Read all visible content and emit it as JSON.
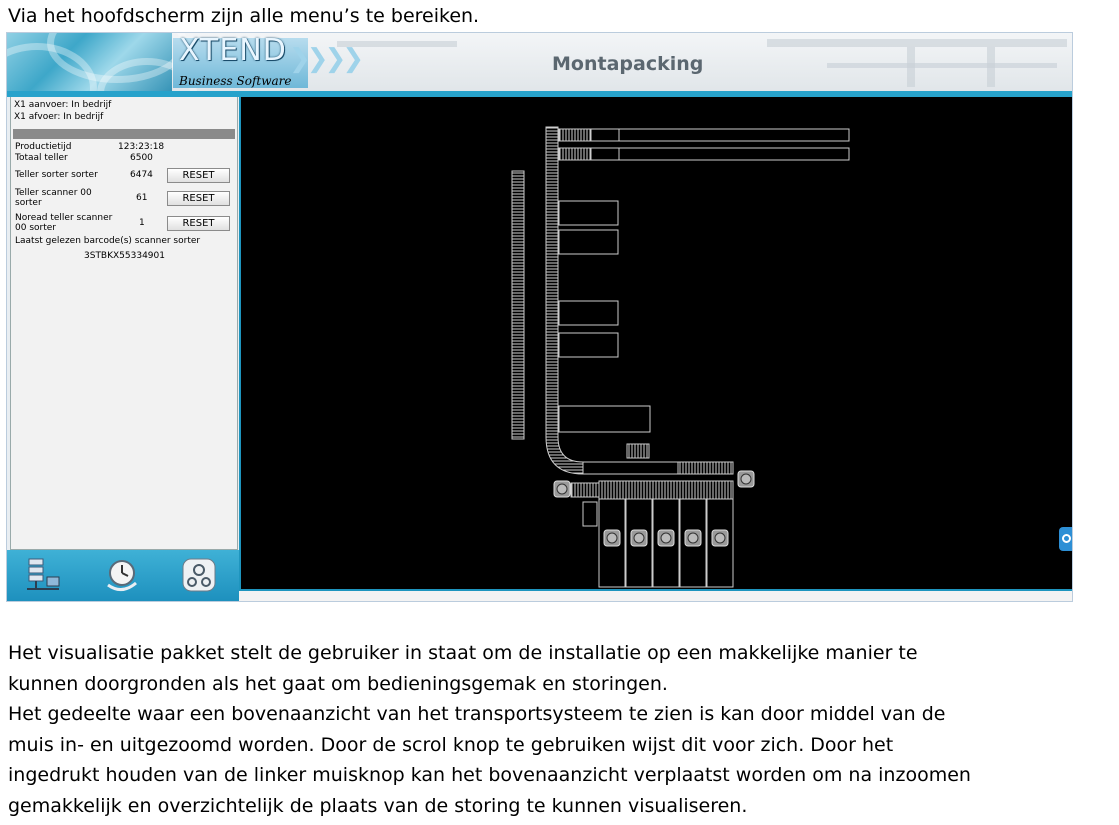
{
  "intro": "Via het hoofdscherm zijn alle menu’s te bereiken.",
  "app": {
    "logo_word": "XTEND",
    "logo_subtitle": "Business Software",
    "title": "Montapacking"
  },
  "status": {
    "line1": "X1 aanvoer: In bedrijf",
    "line2": "X1 afvoer:  In bedrijf"
  },
  "counters": {
    "productietijd_label": "Productietijd",
    "productietijd_value": "123:23:18",
    "totaal_label": "Totaal teller",
    "totaal_value": "6500",
    "sorter_label": "Teller sorter sorter",
    "sorter_value": "6474",
    "scanner_label_1": "Teller scanner 00",
    "scanner_label_2": "sorter",
    "scanner_value": "61",
    "noread_label_1": "Noread teller scanner",
    "noread_label_2": "00 sorter",
    "noread_value": "1",
    "reset_label": "RESET",
    "barcode_label": "Laatst gelezen barcode(s) scanner sorter",
    "barcode_value": "3STBKX55334901"
  },
  "toolbar": {
    "icons": [
      "server-network-icon",
      "clock-icon",
      "gauge-icon"
    ]
  },
  "paragraphs": [
    "Het visualisatie pakket stelt de gebruiker in staat om de installatie op een makkelijke manier te",
    "kunnen doorgronden als het gaat om bedieningsgemak en storingen.",
    "Het gedeelte waar een bovenaanzicht van het transportsysteem te zien is kan door middel van de",
    "muis in- en uitgezoomd worden. Door de scrol knop te gebruiken wijst dit voor zich. Door het",
    "ingedrukt houden van de linker muisknop kan het bovenaanzicht verplaatst worden om na inzoomen",
    "gemakkelijk en overzichtelijk de plaats van de storing te kunnen visualiseren."
  ],
  "colors": {
    "accent": "#27a2cb",
    "canvas_bg": "#000000",
    "title_text": "#5b6770"
  }
}
